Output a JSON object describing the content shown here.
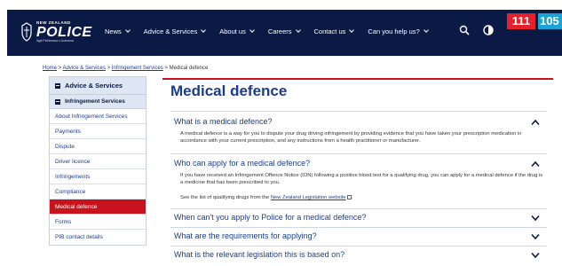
{
  "header": {
    "logo": {
      "small": "NEW ZEALAND",
      "big": "POLICE",
      "motto": "Ngā Pirihimana o Aotearoa"
    },
    "nav": [
      {
        "label": "News"
      },
      {
        "label": "Advice & Services"
      },
      {
        "label": "About us"
      },
      {
        "label": "Careers"
      },
      {
        "label": "Contact us"
      },
      {
        "label": "Can you help us?"
      }
    ],
    "emergency_label": "111",
    "non_emergency_label": "105"
  },
  "breadcrumb": {
    "home": "Home",
    "sep": ">",
    "advice": "Advice & Services",
    "infringement": "Infringement Services",
    "current": "Medical defence"
  },
  "sidebar": {
    "heading": "Advice & Services",
    "subheading": "Infringement Services",
    "items": [
      {
        "label": "About Infringement Services"
      },
      {
        "label": "Payments"
      },
      {
        "label": "Dispute"
      },
      {
        "label": "Driver licence"
      },
      {
        "label": "Infringements"
      },
      {
        "label": "Compliance"
      },
      {
        "label": "Medical defence"
      },
      {
        "label": "Forms"
      },
      {
        "label": "PIB contact details"
      }
    ]
  },
  "main": {
    "title": "Medical defence",
    "sections": [
      {
        "heading": "What is a medical defence?",
        "body": "A medical defence is a way for you to dispute your drug driving infringement by providing evidence that you have taken your prescription medication in accordance with your current prescription, and any instructions from a health practitioner or manufacturer."
      },
      {
        "heading": "Who can apply for a medical defence?",
        "body": "If you have received an Infringement Offence Notice (ION) following a positive blood test for a qualifying drug, you can apply for a medical defence if the drug is a medicine that has been prescribed to you.",
        "link_prefix": "See the list of qualifying drugs from the",
        "link_text": "New Zealand Legislation website"
      },
      {
        "heading": "When can't you apply to Police for a medical defence?"
      },
      {
        "heading": "What are the requirements for applying?"
      },
      {
        "heading": "What is the relevant legislation this is based on?"
      }
    ]
  },
  "colors": {
    "navy": "#0b1a45",
    "link": "#1a3d8f",
    "red": "#c8131f",
    "emergency": "#e4202c",
    "non_emergency": "#19a3d9"
  }
}
